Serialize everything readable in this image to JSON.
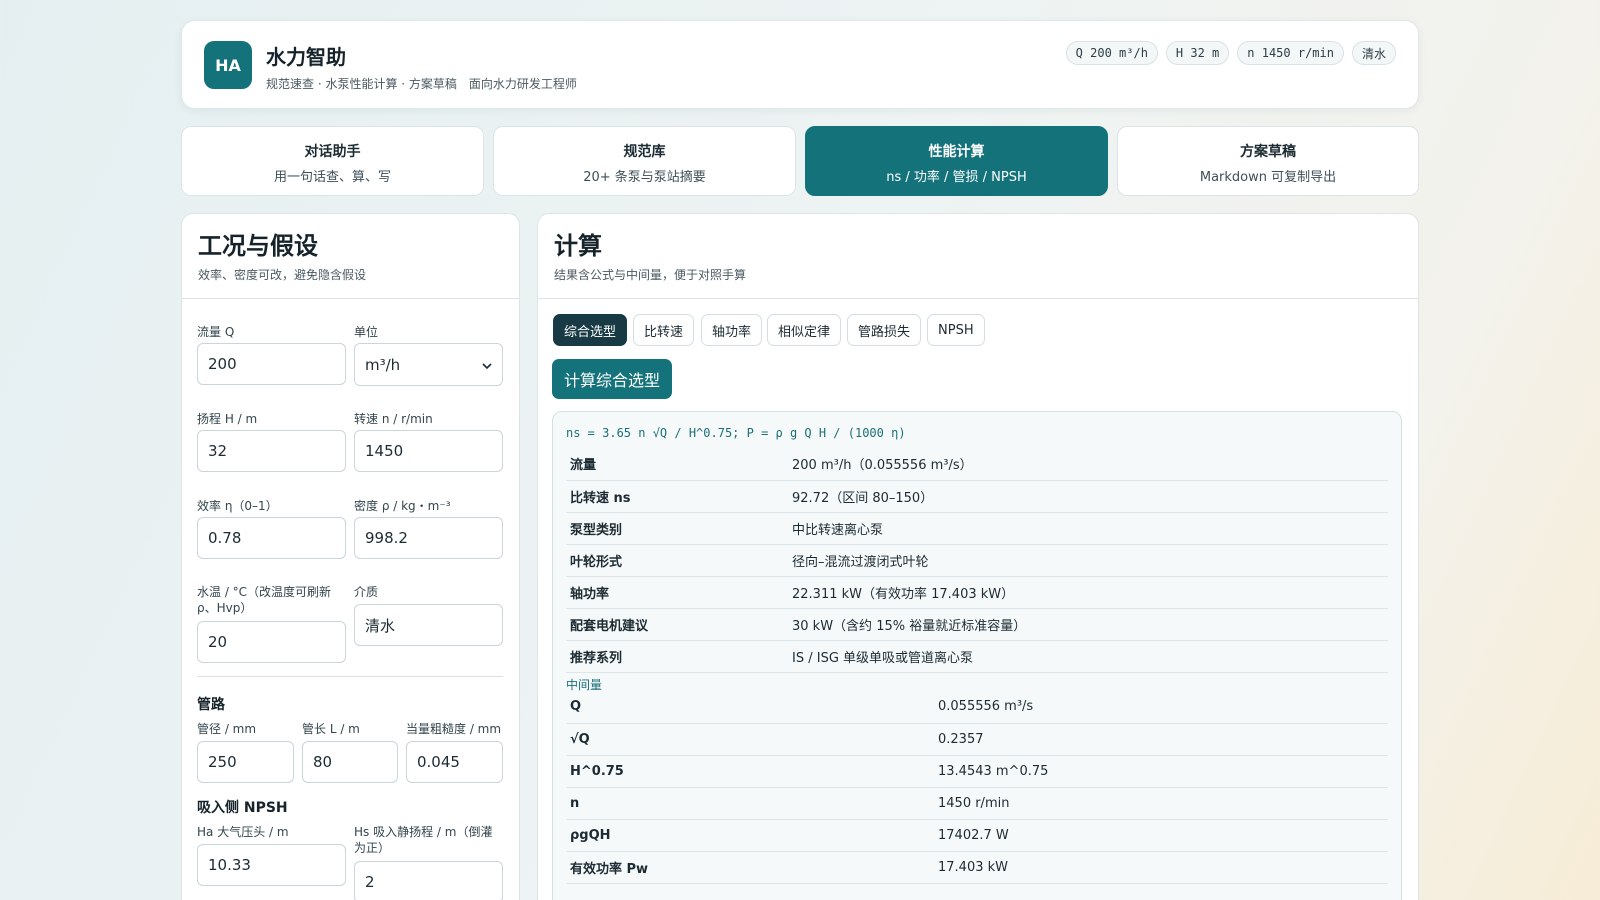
{
  "app": {
    "logo": "HA",
    "title": "水力智助",
    "subtitle": "规范速查 · 水泵性能计算 · 方案草稿　面向水力研发工程师",
    "chips": [
      "Q 200 m³/h",
      "H 32 m",
      "n 1450 r/min",
      "清水"
    ]
  },
  "tabs": [
    {
      "title": "对话助手",
      "desc": "用一句话查、算、写"
    },
    {
      "title": "规范库",
      "desc": "20+ 条泵与泵站摘要"
    },
    {
      "title": "性能计算",
      "desc": "ns / 功率 / 管损 / NPSH"
    },
    {
      "title": "方案草稿",
      "desc": "Markdown 可复制导出"
    }
  ],
  "active_tab": "性能计算",
  "conditions": {
    "title": "工况与假设",
    "subtitle": "效率、密度可改，避免隐含假设",
    "flow_label": "流量 Q",
    "flow_value": "200",
    "unit_label": "单位",
    "unit_value": "m³/h",
    "head_label": "扬程 H / m",
    "head_value": "32",
    "speed_label": "转速 n / r/min",
    "speed_value": "1450",
    "eff_label": "效率 η（0–1）",
    "eff_value": "0.78",
    "density_label": "密度 ρ / kg・m⁻³",
    "density_value": "998.2",
    "temp_label": "水温 / °C（改温度可刷新 ρ、Hvp）",
    "temp_value": "20",
    "medium_label": "介质",
    "medium_value": "清水",
    "pipe_section": "管路",
    "diameter_label": "管径 / mm",
    "diameter_value": "250",
    "length_label": "管长 L / m",
    "length_value": "80",
    "rough_label": "当量粗糙度 / mm",
    "rough_value": "0.045",
    "npsh_section": "吸入侧 NPSH",
    "ha_label": "Ha 大气压头 / m",
    "ha_value": "10.33",
    "hs_label": "Hs 吸入静扬程 / m（倒灌为正）",
    "hs_value": "2"
  },
  "calc": {
    "title": "计算",
    "subtitle": "结果含公式与中间量，便于对照手算",
    "subtabs": [
      "综合选型",
      "比转速",
      "轴功率",
      "相似定律",
      "管路损失",
      "NPSH"
    ],
    "active_subtab": "综合选型",
    "button": "计算综合选型",
    "formula": "ns = 3.65 n √Q / H^0.75; P = ρ g Q H / (1000 η)",
    "results": [
      {
        "k": "流量",
        "v": "200 m³/h（0.055556 m³/s）"
      },
      {
        "k": "比转速 ns",
        "v": "92.72（区间 80–150）"
      },
      {
        "k": "泵型类别",
        "v": "中比转速离心泵"
      },
      {
        "k": "叶轮形式",
        "v": "径向–混流过渡闭式叶轮"
      },
      {
        "k": "轴功率",
        "v": "22.311 kW（有效功率 17.403 kW）"
      },
      {
        "k": "配套电机建议",
        "v": "30 kW（含约 15% 裕量就近标准容量）"
      },
      {
        "k": "推荐系列",
        "v": "IS / ISG 单级单吸或管道离心泵"
      }
    ],
    "intermediate_label": "中间量",
    "intermediate": [
      {
        "k": "Q",
        "v": "0.055556 m³/s"
      },
      {
        "k": "√Q",
        "v": "0.2357"
      },
      {
        "k": "H^0.75",
        "v": "13.4543 m^0.75"
      },
      {
        "k": "n",
        "v": "1450 r/min"
      },
      {
        "k": "ρgQH",
        "v": "17402.7 W"
      },
      {
        "k": "有效功率 Pw",
        "v": "17.403 kW"
      }
    ]
  }
}
